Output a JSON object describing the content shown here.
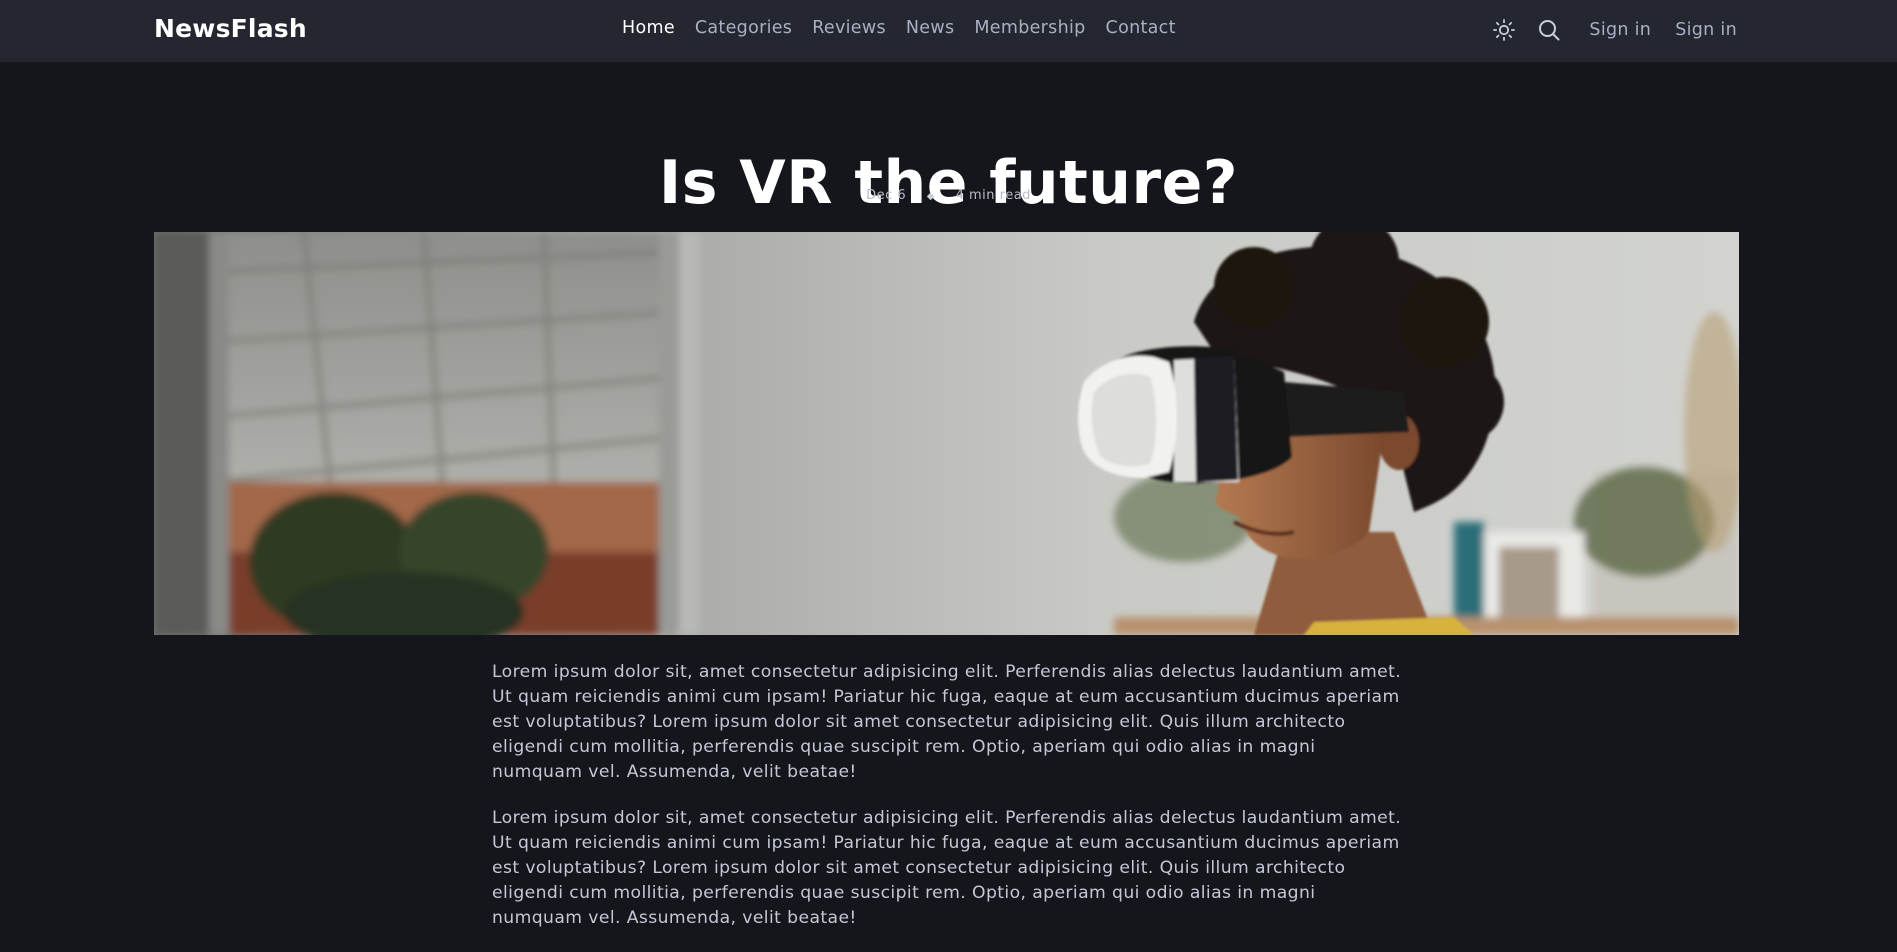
{
  "brand": {
    "name": "NewsFlash"
  },
  "nav": {
    "items": [
      {
        "label": "Home",
        "active": true
      },
      {
        "label": "Categories",
        "active": false
      },
      {
        "label": "Reviews",
        "active": false
      },
      {
        "label": "News",
        "active": false
      },
      {
        "label": "Membership",
        "active": false
      },
      {
        "label": "Contact",
        "active": false
      }
    ],
    "icons": [
      "sun-icon",
      "search-icon"
    ],
    "signin_1": "Sign in",
    "signin_2": "Sign in"
  },
  "article": {
    "title": "Is VR the future?",
    "date": "Dec 6",
    "separator": "◆",
    "read_time": "4 min read",
    "paragraphs": [
      "Lorem ipsum dolor sit, amet consectetur adipisicing elit. Perferendis alias delectus laudantium amet. Ut quam reiciendis animi cum ipsam! Pariatur hic fuga, eaque at eum accusantium ducimus aperiam est voluptatibus? Lorem ipsum dolor sit amet consectetur adipisicing elit. Quis illum architecto eligendi cum mollitia, perferendis quae suscipit rem. Optio, aperiam qui odio alias in magni numquam vel. Assumenda, velit beatae!",
      "Lorem ipsum dolor sit, amet consectetur adipisicing elit. Perferendis alias delectus laudantium amet. Ut quam reiciendis animi cum ipsam! Pariatur hic fuga, eaque at eum accusantium ducimus aperiam est voluptatibus? Lorem ipsum dolor sit amet consectetur adipisicing elit. Quis illum architecto eligendi cum mollitia, perferendis quae suscipit rem. Optio, aperiam qui odio alias in magni numquam vel. Assumenda, velit beatae!"
    ]
  },
  "colors": {
    "page_bg": "#14161b",
    "navbar_bg": "#242730",
    "nav_text": "#a9b0c5",
    "active_text": "#ffffff",
    "body_text": "#c4c8d6"
  }
}
